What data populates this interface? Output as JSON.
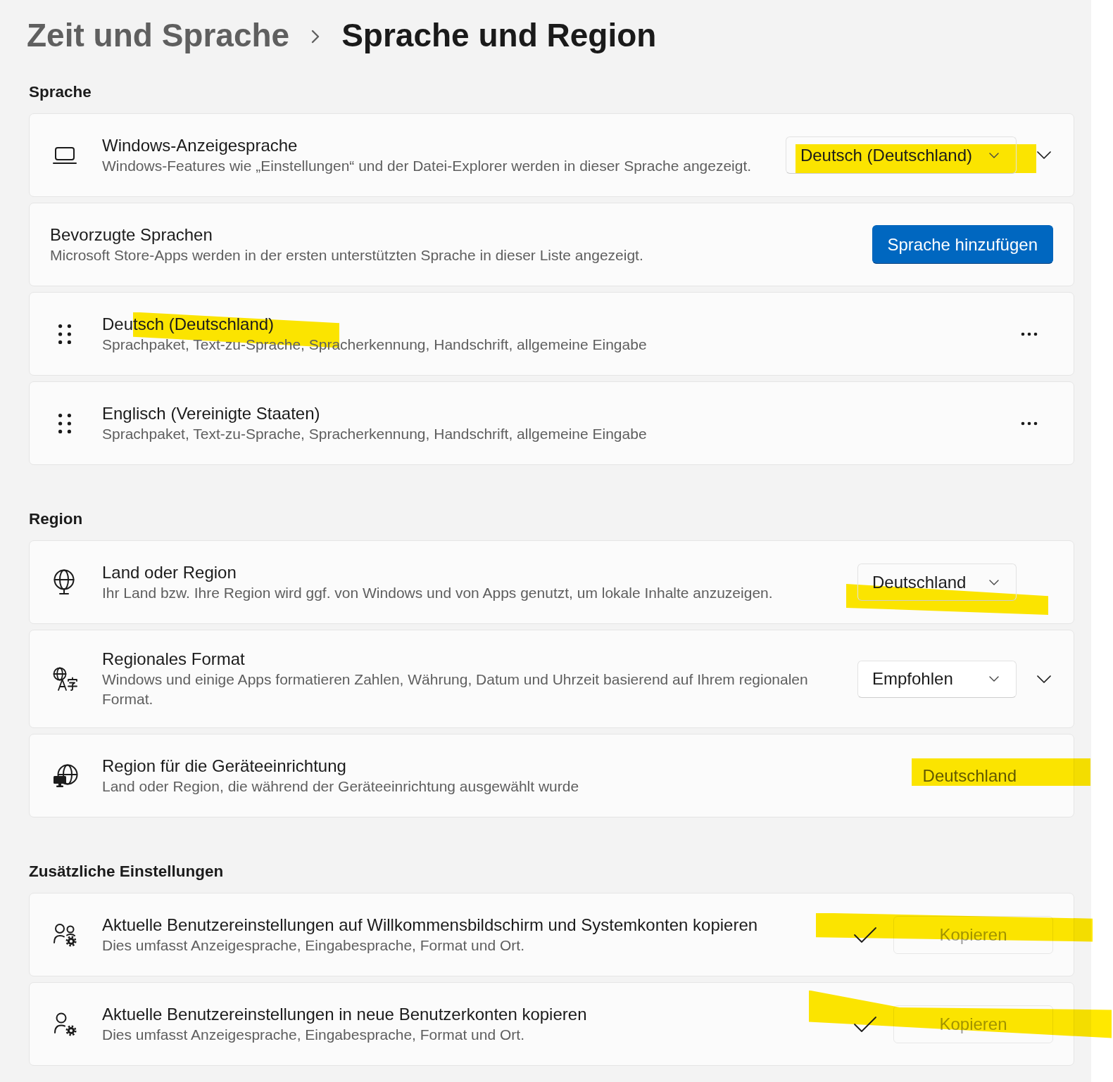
{
  "breadcrumb": {
    "parent": "Zeit und Sprache",
    "current": "Sprache und Region"
  },
  "sections": [
    {
      "title": "Sprache",
      "rows": [
        {
          "kind": "dropdown",
          "title": "Windows-Anzeigesprache",
          "description": "Windows-Features wie „Einstellungen“ und der Datei-Explorer werden in dieser Sprache angezeigt.",
          "value": "Deutsch (Deutschland)",
          "expanded": false,
          "highlighted": true
        },
        {
          "kind": "action",
          "title": "Bevorzugte Sprachen",
          "description": "Microsoft Store-Apps werden in der ersten unterstützten Sprache in dieser Liste angezeigt.",
          "button": "Sprache hinzufügen",
          "highlighted": false
        },
        {
          "kind": "language",
          "title": "Deutsch (Deutschland)",
          "description": "Sprachpaket, Text-zu-Sprache, Spracherkennung, Handschrift, allgemeine Eingabe",
          "highlighted": true
        },
        {
          "kind": "language",
          "title": "Englisch (Vereinigte Staaten)",
          "description": "Sprachpaket, Text-zu-Sprache, Spracherkennung, Handschrift, allgemeine Eingabe",
          "highlighted": false
        }
      ]
    },
    {
      "title": "Region",
      "rows": [
        {
          "kind": "dropdown",
          "title": "Land oder Region",
          "description": "Ihr Land bzw. Ihre Region wird ggf. von Windows und von Apps genutzt, um lokale Inhalte anzuzeigen.",
          "value": "Deutschland",
          "highlighted": true
        },
        {
          "kind": "dropdown",
          "title": "Regionales Format",
          "description": "Windows und einige Apps formatieren Zahlen, Währung, Datum und Uhrzeit basierend auf Ihrem regionalen Format.",
          "value": "Empfohlen",
          "expanded": false,
          "highlighted": false
        },
        {
          "kind": "info",
          "title": "Region für die Geräteeinrichtung",
          "description": "Land oder Region, die während der Geräteeinrichtung ausgewählt wurde",
          "value": "Deutschland",
          "highlighted": true
        }
      ]
    },
    {
      "title": "Zusätzliche Einstellungen",
      "rows": [
        {
          "kind": "copy",
          "title": "Aktuelle Benutzereinstellungen auf Willkommensbildschirm und Systemkonten kopieren",
          "description": "Dies umfasst Anzeigesprache, Eingabesprache, Format und Ort.",
          "completed": true,
          "button": "Kopieren",
          "disabled": true,
          "highlighted": true
        },
        {
          "kind": "copy",
          "title": "Aktuelle Benutzereinstellungen in neue Benutzerkonten kopieren",
          "description": "Dies umfasst Anzeigesprache, Eingabesprache, Format und Ort.",
          "completed": true,
          "button": "Kopieren",
          "disabled": true,
          "highlighted": true
        }
      ]
    }
  ]
}
